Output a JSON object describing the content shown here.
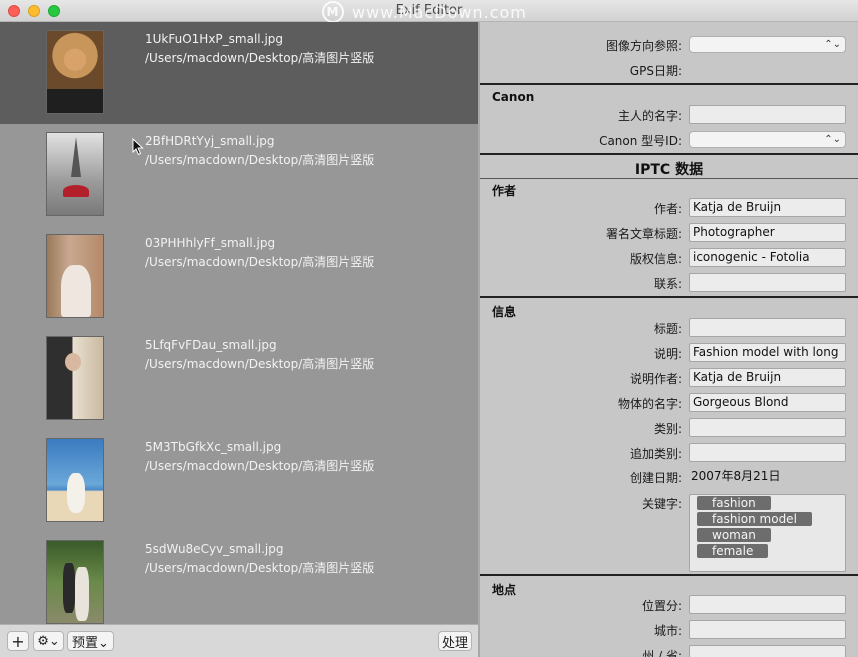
{
  "window": {
    "title": "Exif Editor",
    "watermark": "www.MacDown.com",
    "watermark_logo": "M"
  },
  "files": [
    {
      "name": "1UkFuO1HxP_small.jpg",
      "path": "/Users/macdown/Desktop/高清图片竖版",
      "thumb_colors": [
        "#6a4a2a",
        "#c8955a",
        "#2b2b2b"
      ]
    },
    {
      "name": "2BfHDRtYyj_small.jpg",
      "path": "/Users/macdown/Desktop/高清图片竖版",
      "thumb_colors": [
        "#c9c9c9",
        "#8a8a8a",
        "#b3202b"
      ]
    },
    {
      "name": "03PHHhlyFf_small.jpg",
      "path": "/Users/macdown/Desktop/高清图片竖版",
      "thumb_colors": [
        "#b48a6a",
        "#e9ddd6",
        "#7a5a4a"
      ]
    },
    {
      "name": "5LfqFvFDau_small.jpg",
      "path": "/Users/macdown/Desktop/高清图片竖版",
      "thumb_colors": [
        "#3a3a3a",
        "#e8e0d0",
        "#c9b9a0"
      ]
    },
    {
      "name": "5M3TbGfkXc_small.jpg",
      "path": "/Users/macdown/Desktop/高清图片竖版",
      "thumb_colors": [
        "#4a8ac8",
        "#e8d8b8",
        "#2a6aa8"
      ]
    },
    {
      "name": "5sdWu8eCyv_small.jpg",
      "path": "/Users/macdown/Desktop/高清图片竖版",
      "thumb_colors": [
        "#4a6a3a",
        "#2a2a2a",
        "#8a8a6a"
      ]
    }
  ],
  "bottom_bar": {
    "add_label": "+",
    "gear_label": "⚙︎⌄",
    "preset_label": "预置⌄",
    "process_label": "处理"
  },
  "gps": {
    "orientation_label": "图像方向参照:",
    "gps_date_label": "GPS日期:"
  },
  "canon": {
    "title": "Canon",
    "owner_label": "主人的名字:",
    "owner_value": "",
    "model_id_label": "Canon 型号ID:"
  },
  "iptc": {
    "title": "IPTC 数据"
  },
  "author": {
    "title": "作者",
    "creator_label": "作者:",
    "creator_value": "Katja de Bruijn",
    "byline_title_label": "署名文章标题:",
    "byline_title_value": "Photographer",
    "copyright_label": "版权信息:",
    "copyright_value": "iconogenic - Fotolia",
    "contact_label": "联系:",
    "contact_value": ""
  },
  "info": {
    "title": "信息",
    "headline_label": "标题:",
    "headline_value": "",
    "caption_label": "说明:",
    "caption_value": "Fashion model with long",
    "caption_writer_label": "说明作者:",
    "caption_writer_value": "Katja de Bruijn",
    "object_name_label": "物体的名字:",
    "object_name_value": "Gorgeous Blond",
    "category_label": "类别:",
    "category_value": "",
    "supp_category_label": "追加类别:",
    "supp_category_value": "",
    "date_created_label": "创建日期:",
    "date_created_value": "2007年8月21日",
    "keywords_label": "关键字:",
    "keywords": [
      "fashion",
      "fashion model",
      "woman",
      "female"
    ]
  },
  "location": {
    "title": "地点",
    "sublocation_label": "位置分:",
    "city_label": "城市:",
    "state_label": "州 / 省:"
  },
  "colors": {
    "selected_row": "#5d5d5d",
    "list_background": "#979797",
    "panel_background": "#c7c7c7",
    "token_background": "#6d6d6d"
  }
}
